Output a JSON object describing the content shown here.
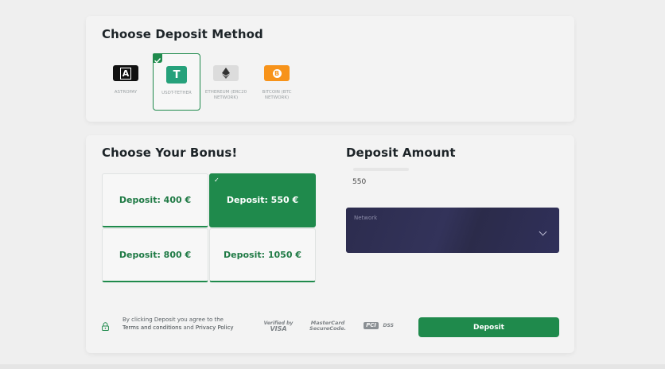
{
  "method_section": {
    "title": "Choose Deposit Method",
    "methods": [
      {
        "label": "ASTROPAY",
        "logo_text": "A",
        "logo_color": "#111111",
        "selected": false
      },
      {
        "label": "USDT-TETHER",
        "logo_text": "T",
        "logo_color": "#26a17b",
        "selected": true
      },
      {
        "label": "ETHEREUM (ERC20 NETWORK)",
        "logo_text": "",
        "logo_color": "#d9d9d9",
        "selected": false
      },
      {
        "label": "BITCOIN (BTC NETWORK)",
        "logo_text": "B",
        "logo_color": "#f7931a",
        "selected": false
      }
    ]
  },
  "bonus_section": {
    "title": "Choose Your Bonus!",
    "options": [
      {
        "label": "Deposit: 400 €",
        "selected": false
      },
      {
        "label": "Deposit: 550 €",
        "selected": true
      },
      {
        "label": "Deposit: 800 €",
        "selected": false
      },
      {
        "label": "Deposit: 1050 €",
        "selected": false
      }
    ],
    "check_glyph": "✓"
  },
  "amount_section": {
    "title": "Deposit Amount",
    "amount_value": "550",
    "network_label": "Network"
  },
  "footer": {
    "terms_prefix": "By clicking Deposit you agree to the",
    "terms_link": "Terms and conditions",
    "terms_and": " and ",
    "privacy_link": "Privacy Policy",
    "payment_logos": [
      {
        "line1": "Verified by",
        "line2": "VISA"
      },
      {
        "line1": "MasterCard",
        "line2": "SecureCode."
      },
      {
        "line1": "PCI",
        "line2": "DSS"
      }
    ],
    "deposit_label": "Deposit"
  },
  "colors": {
    "accent": "#1f8a4c",
    "network_bg": "#2d2d4e"
  }
}
